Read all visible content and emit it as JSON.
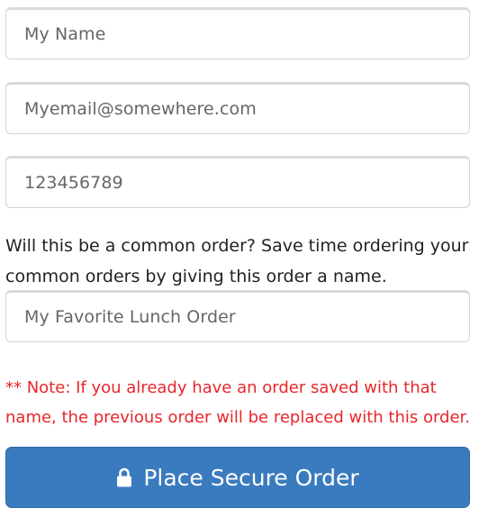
{
  "form": {
    "name_field": {
      "placeholder": "My Name"
    },
    "email_field": {
      "placeholder": "Myemail@somewhere.com"
    },
    "phone_field": {
      "placeholder": "123456789"
    },
    "common_order_prompt": "Will this be a common order? Save time ordering your common orders by giving this order a name.",
    "order_name_field": {
      "placeholder": "My Favorite Lunch Order"
    },
    "note": "** Note: If you already have an order saved with that name, the previous order will be replaced with this order.",
    "submit_label": "Place Secure Order",
    "submit_icon": "lock-icon",
    "colors": {
      "submit_bg": "#3a7bbf",
      "note_text": "#e8262b"
    }
  }
}
